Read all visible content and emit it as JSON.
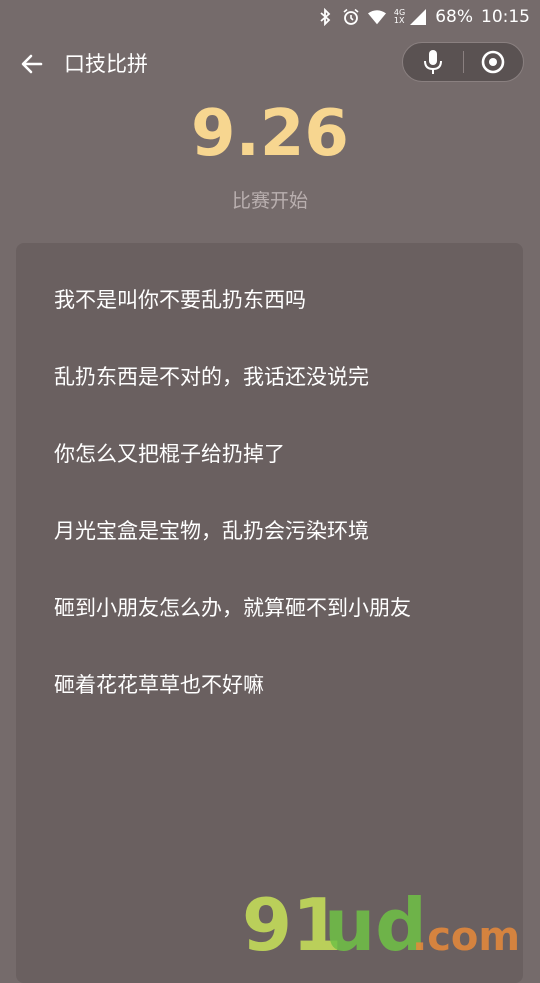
{
  "status_bar": {
    "battery": "68%",
    "time": "10:15",
    "net_top": "4G",
    "net_bottom": "1X"
  },
  "header": {
    "title": "口技比拼"
  },
  "score": {
    "value": "9.26",
    "status": "比赛开始"
  },
  "lyrics": [
    "我不是叫你不要乱扔东西吗",
    "乱扔东西是不对的，我话还没说完",
    "你怎么又把棍子给扔掉了",
    "月光宝盒是宝物，乱扔会污染环境",
    "砸到小朋友怎么办，就算砸不到小朋友",
    "砸着花花草草也不好嘛"
  ],
  "watermark": {
    "brand": "91ud",
    "suffix": ".com"
  },
  "colors": {
    "background": "#756b6b",
    "card": "#6a6060",
    "score": "#f7d690",
    "muted_text": "#b9afaf"
  }
}
